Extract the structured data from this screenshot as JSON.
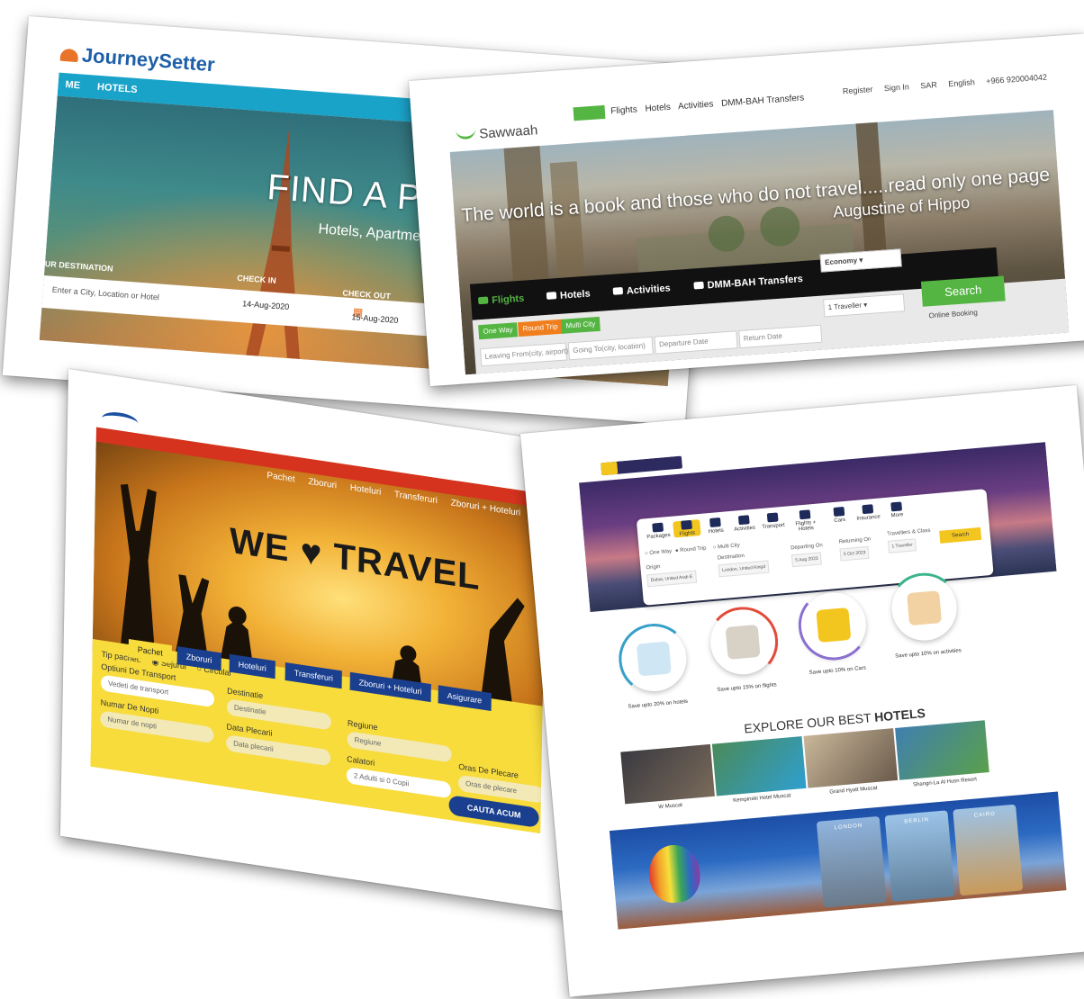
{
  "card1": {
    "logo": "JourneySetter",
    "nav": [
      "ME",
      "HOTELS"
    ],
    "headline": "FIND A PLACE T",
    "subheadline": "Hotels, Apartments & Villas arour",
    "destination_label": "UR DESTINATION",
    "destination_placeholder": "Enter a City, Location or Hotel",
    "checkin_label": "CHECK IN",
    "checkin_value": "14-Aug-2020",
    "checkout_label": "CHECK OUT",
    "checkout_value": "15-Aug-2020"
  },
  "card2": {
    "logo": "Sawwaah",
    "nav": [
      "Home",
      "Flights",
      "Hotels",
      "Activities",
      "DMM-BAH Transfers"
    ],
    "right_links": [
      "Register",
      "Sign In",
      "SAR",
      "English",
      "+966 920004042"
    ],
    "quote_line1": "The world is a book and those who do not travel.....read only one page",
    "quote_line2": "Augustine of Hippo",
    "tabs": [
      "Flights",
      "Hotels",
      "Activities",
      "DMM-BAH Transfers"
    ],
    "trip_types": [
      "One Way",
      "Round Trip",
      "Multi City"
    ],
    "fields": [
      "Leaving From(city, airport)",
      "Going To(city, location)",
      "Departure Date",
      "Return Date"
    ],
    "class_select": "Economy",
    "travellers_select": "1 Traveller",
    "search_button": "Search",
    "online_check": "Online Booking"
  },
  "card3": {
    "nav": [
      "Pachet",
      "Zboruri",
      "Hoteluri",
      "Transferuri",
      "Zboruri + Hoteluri"
    ],
    "slogan_left": "WE",
    "slogan_heart": "♥",
    "slogan_right": "TRAVEL",
    "tabs": [
      "Pachet",
      "Zboruri",
      "Hoteluri",
      "Transferuri",
      "Zboruri + Hoteluri",
      "Asigurare"
    ],
    "tip_label": "Tip pachet:",
    "tip_options": [
      "Sejurul",
      "Circular"
    ],
    "transport_label": "Optiuni De Transport",
    "transport_value": "Vedeti de transport",
    "nights_label": "Numar De Nopti",
    "nights_value": "Numar de nopti",
    "destination_label": "Destinatie",
    "destination_value": "Destinatie",
    "departure_label": "Data Plecarii",
    "departure_value": "Data plecarii",
    "region_label": "Regiune",
    "region_value": "Regiune",
    "travelers_label": "Calatori",
    "travelers_value": "2 Adulti si 0 Copii",
    "origin_label": "Oras De Plecare",
    "origin_value": "Oras de plecare",
    "search_button": "CAUTA ACUM"
  },
  "card4": {
    "categories": [
      "Packages",
      "Flights",
      "Hotels",
      "Activities",
      "Transport",
      "Flights + Hotels",
      "Cars",
      "Insurance",
      "More"
    ],
    "trip_types": [
      "One Way",
      "Round Trip",
      "Multi City"
    ],
    "origin_label": "Origin",
    "origin_value": "Dubai, United Arab E",
    "destination_label": "Destination",
    "destination_value": "London, United Kingd",
    "departing_label": "Departing On",
    "departing_value": "5 Aug 2023",
    "returning_label": "Returning On",
    "returning_value": "5 Oct 2023",
    "travellers_label": "Travellers & Class",
    "travellers_value": "1 Traveller",
    "search_button": "Search",
    "features": [
      "Save upto 20% on hotels",
      "Save upto 15% on flights",
      "Save upto 10% on Cars",
      "Save upto 10% on activities"
    ],
    "explore_title_plain": "EXPLORE OUR BEST",
    "explore_title_bold": "HOTELS",
    "hotels": [
      "W Muscat",
      "Kempinski Hotel Muscat",
      "Grand Hyatt Muscat",
      "Shangri-La Al Husn Resort"
    ],
    "destinations": [
      "LONDON",
      "BERLIN",
      "CAIRO"
    ],
    "colors": {
      "accent": "#f3c61f",
      "navy": "#2c2a5e"
    }
  }
}
